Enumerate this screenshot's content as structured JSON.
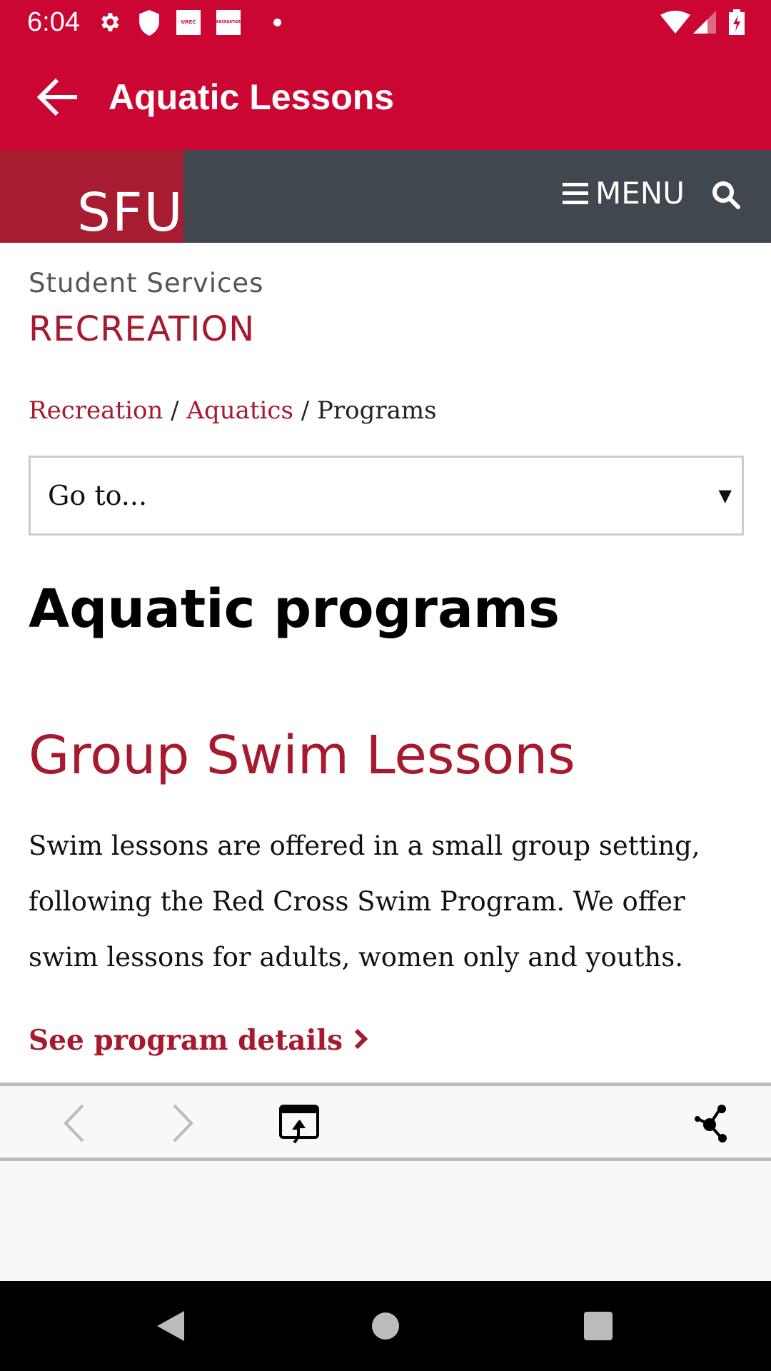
{
  "status_bar": {
    "time": "6:04",
    "icons": [
      "gear-icon",
      "shield-icon",
      "urec-app-icon",
      "recreation-app-icon",
      "dot-icon",
      "wifi-icon",
      "signal-icon",
      "battery-charging-icon"
    ],
    "urec_label": "UREC",
    "recreation_label": "RECREATION"
  },
  "app_bar": {
    "title": "Aquatic Lessons",
    "color": "#CC0633"
  },
  "site_header": {
    "logo": "SFU",
    "menu_label": "MENU",
    "logo_bg": "#A71C30",
    "bar_bg": "#41474F"
  },
  "section": {
    "subtitle": "Student Services",
    "title": "RECREATION"
  },
  "breadcrumb": {
    "items": [
      "Recreation",
      "Aquatics"
    ],
    "current": "Programs"
  },
  "goto_select": {
    "value": "Go to..."
  },
  "main": {
    "heading": "Aquatic programs",
    "subheading": "Group Swim Lessons",
    "body": "Swim lessons are offered in a small group setting, following the Red Cross Swim Program. We offer swim lessons for adults, women only and youths.",
    "link": "See program details",
    "accent": "#A6192E"
  },
  "browser_toolbar": {
    "icons": [
      "back-chevron-icon",
      "forward-chevron-icon",
      "open-in-browser-icon",
      "share-icon"
    ]
  }
}
